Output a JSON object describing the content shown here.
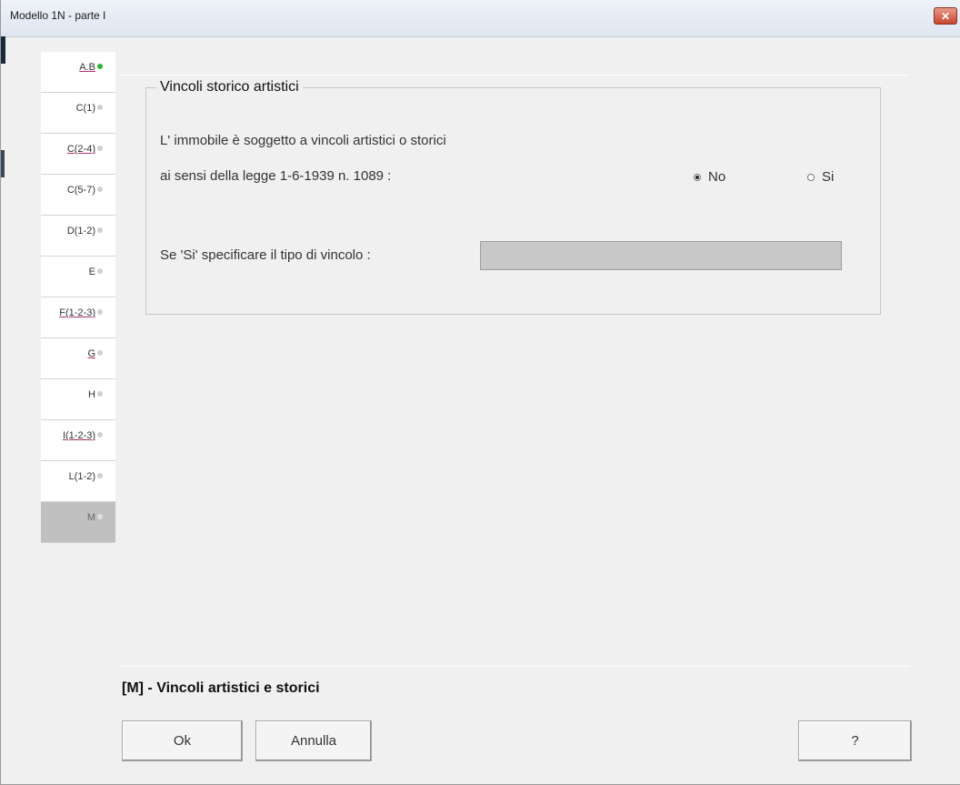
{
  "window": {
    "title": "Modello 1N  -  parte I",
    "close_label": "✕"
  },
  "tabs": [
    {
      "label": "A.B",
      "status": "complete",
      "underlined": true
    },
    {
      "label": "C(1)",
      "status": "empty",
      "underlined": false
    },
    {
      "label": "C(2-4)",
      "status": "empty",
      "underlined": true
    },
    {
      "label": "C(5-7)",
      "status": "empty",
      "underlined": false
    },
    {
      "label": "D(1-2)",
      "status": "empty",
      "underlined": false
    },
    {
      "label": "E",
      "status": "empty",
      "underlined": false
    },
    {
      "label": "F(1-2-3)",
      "status": "empty",
      "underlined": true
    },
    {
      "label": "G",
      "status": "empty",
      "underlined": true
    },
    {
      "label": "H",
      "status": "empty",
      "underlined": false
    },
    {
      "label": "I(1-2-3)",
      "status": "empty",
      "underlined": true
    },
    {
      "label": "L(1-2)",
      "status": "empty",
      "underlined": false
    },
    {
      "label": "M",
      "status": "active",
      "underlined": false
    }
  ],
  "group": {
    "legend": "Vincoli storico artistici",
    "question_line1": "L' immobile è soggetto a vincoli artistici o storici",
    "question_line2": "ai sensi della legge 1-6-1939 n. 1089 :",
    "radio_no_label": "No",
    "radio_si_label": "Si",
    "selected": "No",
    "specify_label": "Se 'Si' specificare il tipo di vincolo :",
    "specify_value": ""
  },
  "section_title": "[M] - Vincoli artistici e storici",
  "buttons": {
    "ok": "Ok",
    "annulla": "Annulla",
    "help": "?"
  },
  "colors": {
    "status_complete": "#2fb53a",
    "status_empty": "#cfcfcf"
  }
}
